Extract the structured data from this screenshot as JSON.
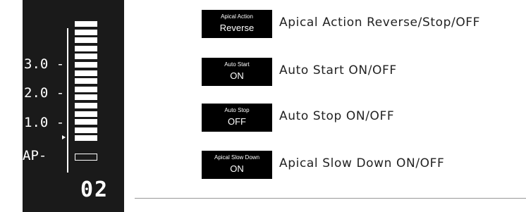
{
  "gauge": {
    "tick_labels": [
      "3.0 -",
      "2.0 -",
      "1.0 -",
      "AP-"
    ],
    "filled_segments": 15,
    "empty_segments": 1,
    "readout": "02"
  },
  "settings": [
    {
      "badge_top": "Apical Action",
      "badge_bottom": "Reverse",
      "description": "Apical Action Reverse/Stop/OFF"
    },
    {
      "badge_top": "Auto Start",
      "badge_bottom": "ON",
      "description": "Auto Start ON/OFF"
    },
    {
      "badge_top": "Auto Stop",
      "badge_bottom": "OFF",
      "description": "Auto Stop ON/OFF"
    },
    {
      "badge_top": "Apical Slow Down",
      "badge_bottom": "ON",
      "description": "Apical Slow Down ON/OFF"
    }
  ],
  "colors": {
    "panel": "#1a1a1a",
    "badge": "#000000",
    "text": "#222222"
  }
}
